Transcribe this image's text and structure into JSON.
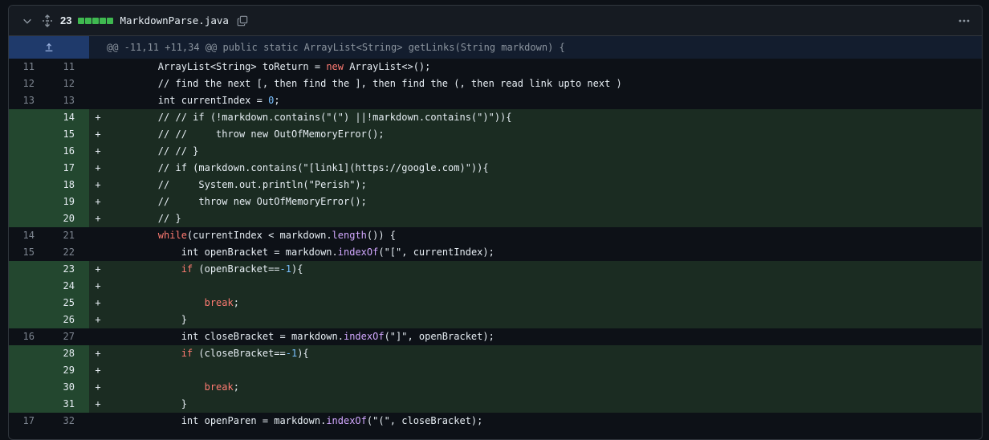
{
  "header": {
    "additions_count": "23",
    "filename": "MarkdownParse.java",
    "blocks": 5,
    "accent": "#3fb950"
  },
  "hunk": {
    "text": "@@ -11,11 +11,34 @@ public static ArrayList<String> getLinks(String markdown) {"
  },
  "lines": [
    {
      "type": "ctx",
      "old": "11",
      "new": "11",
      "code": "        ArrayList<String> toReturn = new ArrayList<>();"
    },
    {
      "type": "ctx",
      "old": "12",
      "new": "12",
      "code": "        // find the next [, then find the ], then find the (, then read link upto next )"
    },
    {
      "type": "ctx",
      "old": "13",
      "new": "13",
      "code": "        int currentIndex = 0;"
    },
    {
      "type": "add",
      "old": "",
      "new": "14",
      "code": "        // // if (!markdown.contains(\"(\") ||!markdown.contains(\")\")){"
    },
    {
      "type": "add",
      "old": "",
      "new": "15",
      "code": "        // //     throw new OutOfMemoryError();"
    },
    {
      "type": "add",
      "old": "",
      "new": "16",
      "code": "        // // }"
    },
    {
      "type": "add",
      "old": "",
      "new": "17",
      "code": "        // if (markdown.contains(\"[link1](https://google.com)\")){"
    },
    {
      "type": "add",
      "old": "",
      "new": "18",
      "code": "        //     System.out.println(\"Perish\");"
    },
    {
      "type": "add",
      "old": "",
      "new": "19",
      "code": "        //     throw new OutOfMemoryError();"
    },
    {
      "type": "add",
      "old": "",
      "new": "20",
      "code": "        // }"
    },
    {
      "type": "ctx",
      "old": "14",
      "new": "21",
      "code": "        while(currentIndex < markdown.length()) {"
    },
    {
      "type": "ctx",
      "old": "15",
      "new": "22",
      "code": "            int openBracket = markdown.indexOf(\"[\", currentIndex);"
    },
    {
      "type": "add",
      "old": "",
      "new": "23",
      "code": "            if (openBracket==-1){"
    },
    {
      "type": "add",
      "old": "",
      "new": "24",
      "code": ""
    },
    {
      "type": "add",
      "old": "",
      "new": "25",
      "code": "                break;"
    },
    {
      "type": "add",
      "old": "",
      "new": "26",
      "code": "            }"
    },
    {
      "type": "ctx",
      "old": "16",
      "new": "27",
      "code": "            int closeBracket = markdown.indexOf(\"]\", openBracket);"
    },
    {
      "type": "add",
      "old": "",
      "new": "28",
      "code": "            if (closeBracket==-1){"
    },
    {
      "type": "add",
      "old": "",
      "new": "29",
      "code": ""
    },
    {
      "type": "add",
      "old": "",
      "new": "30",
      "code": "                break;"
    },
    {
      "type": "add",
      "old": "",
      "new": "31",
      "code": "            }"
    },
    {
      "type": "ctx",
      "old": "17",
      "new": "32",
      "code": "            int openParen = markdown.indexOf(\"(\", closeBracket);"
    }
  ]
}
